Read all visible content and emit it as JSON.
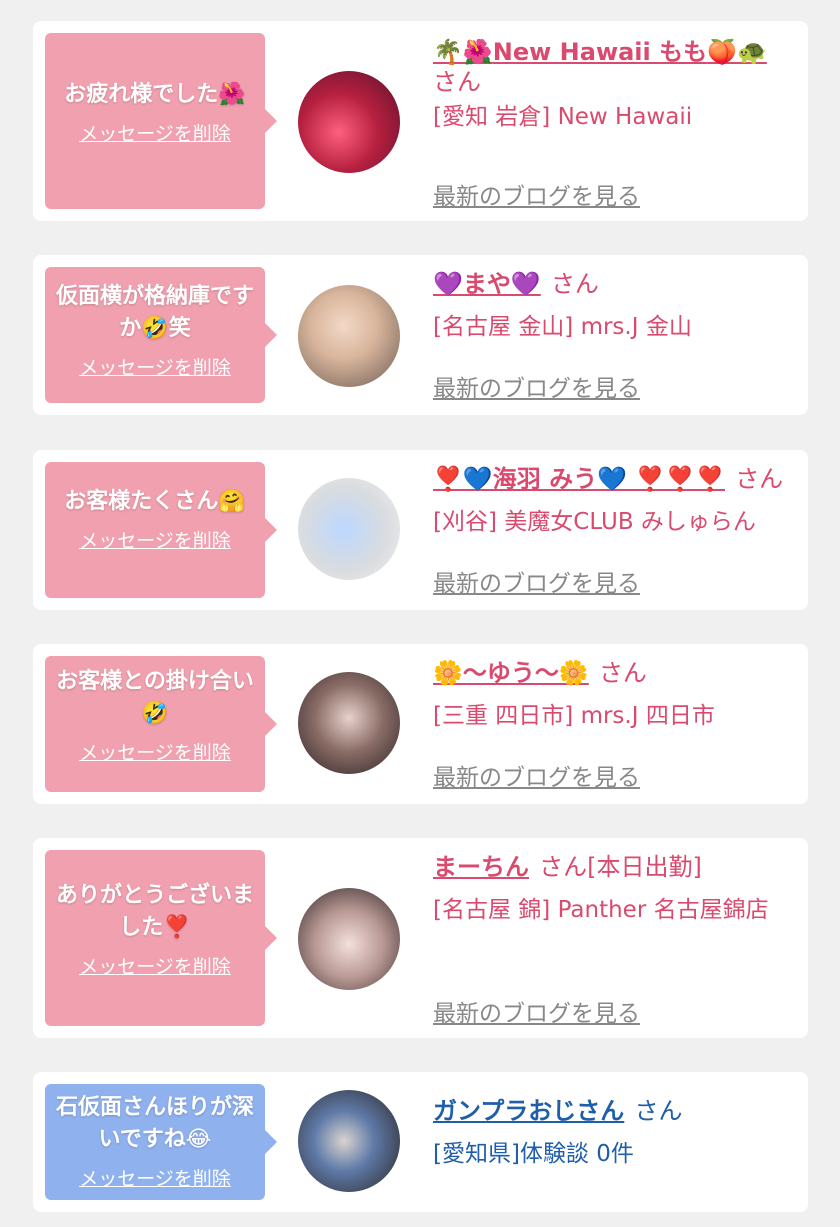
{
  "colors": {
    "pink_bubble": "#f0a0ae",
    "blue_bubble": "#8fb1ee",
    "name_pink": "#d94a6e",
    "name_blue": "#1f5ea8",
    "link_gray": "#888888"
  },
  "delete_label": "メッセージを削除",
  "blog_label": "最新のブログを見る",
  "san": "さん",
  "cards": [
    {
      "message": "お疲れ様でした",
      "message_emoji": "🌺",
      "name_prefix": "🌴🌺",
      "name": "New Hawaii もも",
      "name_suffix": "🍑🐢",
      "san": "さん",
      "shop": "[愛知 岩倉] New Hawaii"
    },
    {
      "message": "仮面横が格納庫ですか🤣笑",
      "name": "💜まや💜",
      "san": "さん",
      "shop": "[名古屋 金山] mrs.J 金山"
    },
    {
      "message": "お客様たくさん🤗",
      "name": "❣️💙海羽 みう💙 ❣️❣️❣️",
      "san": "さん",
      "shop": "[刈谷] 美魔女CLUB みしゅらん"
    },
    {
      "message": "お客様との掛け合い🤣",
      "name": "🌼〜ゆう〜🌼",
      "san": "さん",
      "shop": "[三重 四日市] mrs.J 四日市"
    },
    {
      "message": "ありがとうございました❣️",
      "name": "まーちん",
      "san": "さん[本日出勤]",
      "shop": "[名古屋 錦] Panther 名古屋錦店"
    },
    {
      "message": "石仮面さんほりが深いですね😂",
      "name": "ガンプラおじさん",
      "san": "さん",
      "shop": "[愛知県]体験談 0件"
    }
  ]
}
